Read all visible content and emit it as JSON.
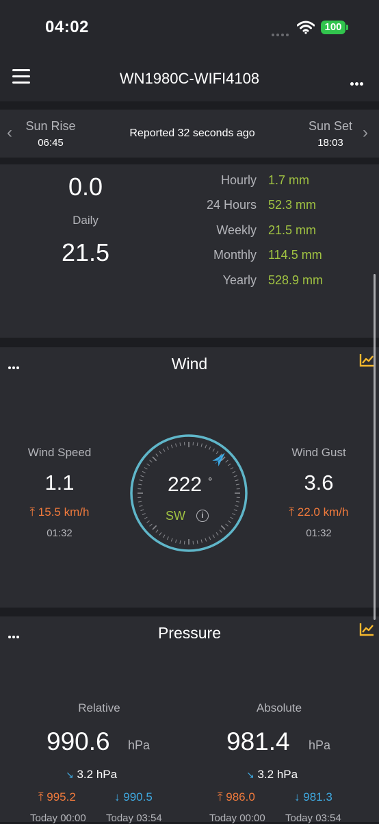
{
  "status_bar": {
    "time": "04:02",
    "battery": "100"
  },
  "header": {
    "title": "WN1980C-WIFI4108"
  },
  "sun": {
    "sunrise_label": "Sun Rise",
    "sunrise_time": "06:45",
    "reported": "Reported 32 seconds ago",
    "sunset_label": "Sun Set",
    "sunset_time": "18:03"
  },
  "rain": {
    "rate": "0.0",
    "daily_label": "Daily",
    "daily": "21.5",
    "rows": [
      {
        "label": "Hourly",
        "value": "1.7 mm"
      },
      {
        "label": "24 Hours",
        "value": "52.3 mm"
      },
      {
        "label": "Weekly",
        "value": "21.5 mm"
      },
      {
        "label": "Monthly",
        "value": "114.5 mm"
      },
      {
        "label": "Yearly",
        "value": "528.9 mm"
      }
    ]
  },
  "wind": {
    "title": "Wind",
    "speed_label": "Wind Speed",
    "speed": "1.1",
    "speed_max": "15.5 km/h",
    "speed_time": "01:32",
    "gust_label": "Wind Gust",
    "gust": "3.6",
    "gust_max": "22.0 km/h",
    "gust_time": "01:32",
    "direction_deg": "222",
    "degree_symbol": "°",
    "direction_name": "SW",
    "direction_value": 222
  },
  "pressure": {
    "title": "Pressure",
    "relative_label": "Relative",
    "relative": "990.6",
    "absolute_label": "Absolute",
    "absolute": "981.4",
    "unit": "hPa",
    "relative_trend": "3.2 hPa",
    "absolute_trend": "3.2 hPa",
    "relative_high": "995.2",
    "relative_low": "990.5",
    "absolute_high": "986.0",
    "absolute_low": "981.3",
    "relative_high_time": "Today 00:00",
    "relative_low_time": "Today 03:54",
    "absolute_high_time": "Today 00:00",
    "absolute_low_time": "Today 03:54"
  },
  "colors": {
    "accent_green": "#a0c242",
    "max_orange": "#f07a3c",
    "min_blue": "#3fa9e0",
    "compass_ring": "#5fb6c9",
    "chart_icon": "#f5b82e"
  }
}
